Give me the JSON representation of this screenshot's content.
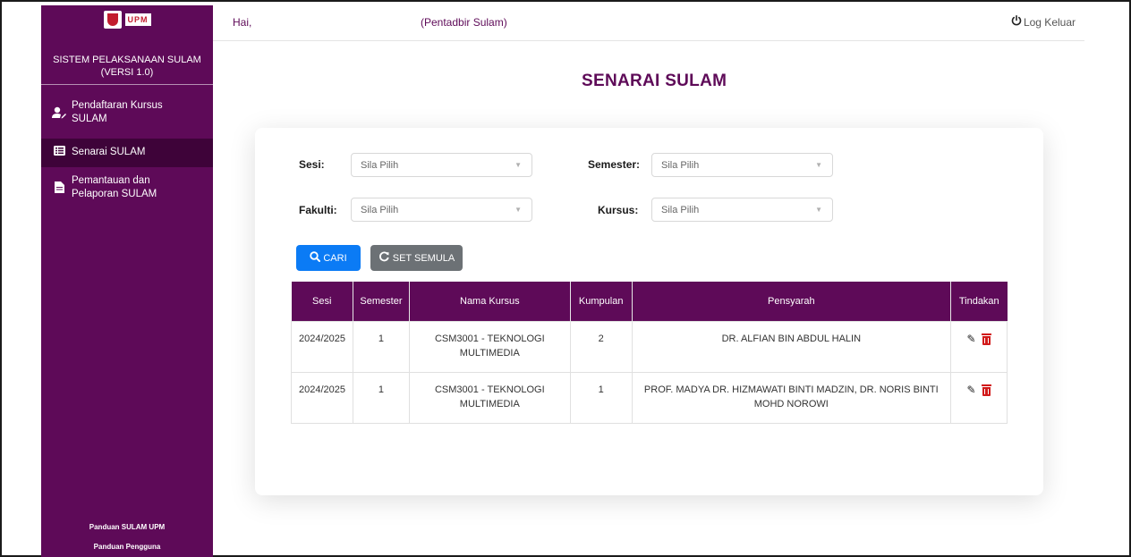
{
  "sidebar": {
    "logo_text": "UPM",
    "system_title_line1": "SISTEM PELAKSANAAN SULAM",
    "system_title_line2": "(VERSI 1.0)",
    "items": [
      {
        "label_line1": "Pendaftaran Kursus",
        "label_line2": "SULAM",
        "icon": "user-edit-icon"
      },
      {
        "label_line1": "Senarai SULAM",
        "label_line2": "",
        "icon": "list-icon"
      },
      {
        "label_line1": "Pemantauan dan",
        "label_line2": "Pelaporan SULAM",
        "icon": "file-icon"
      }
    ],
    "footer": [
      "Panduan SULAM UPM",
      "Panduan Pengguna"
    ]
  },
  "header": {
    "greeting": "Hai,",
    "role": "(Pentadbir Sulam)",
    "logout_label": "Log Keluar",
    "logout_icon": "power-icon"
  },
  "page": {
    "title": "SENARAI SULAM"
  },
  "filters": {
    "sesi_label": "Sesi:",
    "sesi_value": "Sila Pilih",
    "semester_label": "Semester:",
    "semester_value": "Sila Pilih",
    "fakulti_label": "Fakulti:",
    "fakulti_value": "Sila Pilih",
    "kursus_label": "Kursus:",
    "kursus_value": "Sila Pilih"
  },
  "buttons": {
    "search_label": "CARI",
    "search_icon": "search-icon",
    "reset_label": "SET SEMULA",
    "reset_icon": "refresh-icon"
  },
  "table": {
    "headers": [
      "Sesi",
      "Semester",
      "Nama Kursus",
      "Kumpulan",
      "Pensyarah",
      "Tindakan"
    ],
    "rows": [
      {
        "sesi": "2024/2025",
        "semester": "1",
        "kursus_line1": "CSM3001 - TEKNOLOGI",
        "kursus_line2": "MULTIMEDIA",
        "kumpulan": "2",
        "pensyarah_line1": "DR. ALFIAN BIN ABDUL HALIN",
        "pensyarah_line2": ""
      },
      {
        "sesi": "2024/2025",
        "semester": "1",
        "kursus_line1": "CSM3001 - TEKNOLOGI",
        "kursus_line2": "MULTIMEDIA",
        "kumpulan": "1",
        "pensyarah_line1": "PROF. MADYA DR. HIZMAWATI BINTI MADZIN, DR. NORIS BINTI",
        "pensyarah_line2": "MOHD NOROWI"
      }
    ]
  },
  "colors": {
    "brand_purple": "#5e0a58",
    "primary_blue": "#0b7bf5",
    "secondary_gray": "#6c7175",
    "danger_red": "#d11919"
  }
}
